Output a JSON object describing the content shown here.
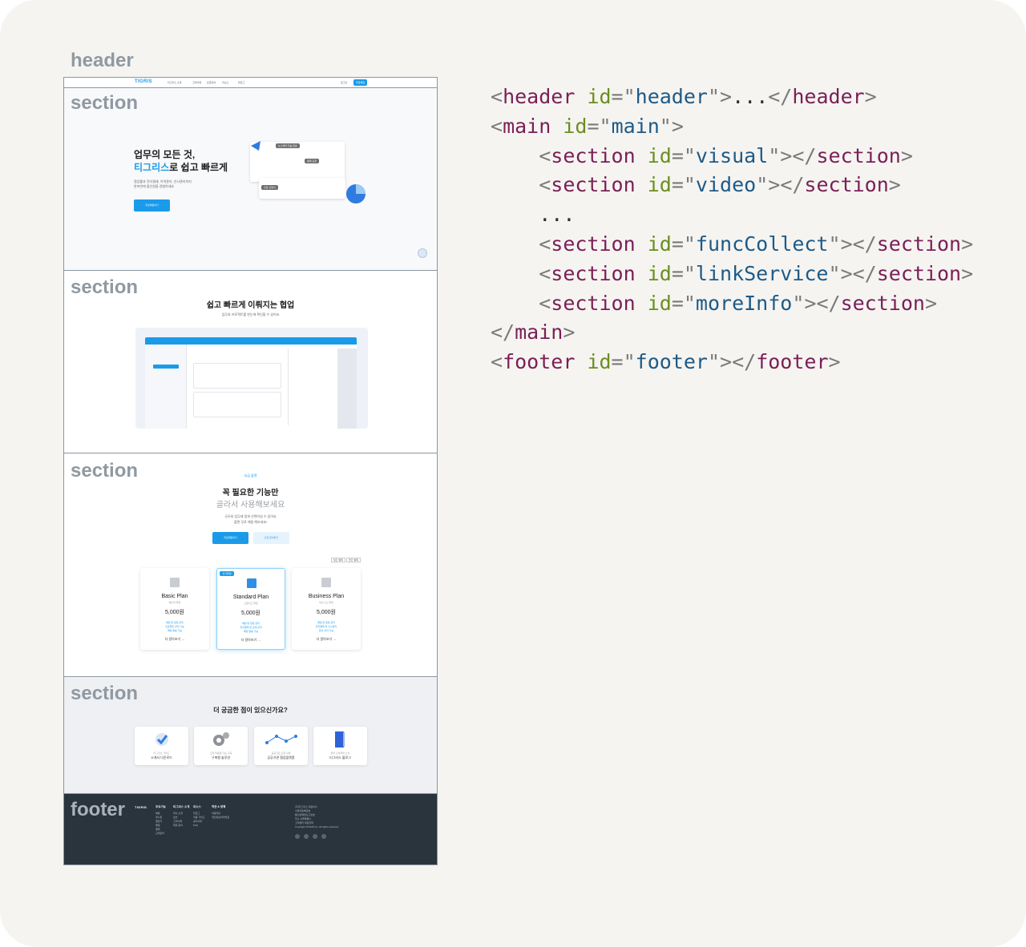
{
  "labels": {
    "header": "header",
    "section": "section",
    "footer": "footer"
  },
  "mock": {
    "header": {
      "logo": "TIGRIS",
      "nav": [
        "티그리스 소개",
        "고객사례",
        "요금안내",
        "리소스",
        "블로그"
      ],
      "login": "로그인",
      "cta": "무료체험"
    },
    "visual": {
      "title_line1": "업무의 모든 것,",
      "title_accent": "티그리스",
      "title_rest": "로 쉽고 빠르게",
      "desc_line1": "협업툴과 전자결재, 이력관리, 인사관리까지",
      "desc_line2": "한꺼번에 올인원을 경험하세요",
      "cta": "무료체험하기",
      "bubbles": [
        "뉴스레터 전송 완료",
        "결재 요청",
        "출장 신청서"
      ]
    },
    "video": {
      "title": "쉽고 빠르게 이뤄지는 협업",
      "subtitle": "업무와 프로젝트를 한눈에 확인할 수 있어요"
    },
    "plan": {
      "badge": "요금 플랜",
      "title": "꼭 필요한 기능만",
      "subtitle": "골라서 사용해보세요",
      "desc_line1": "규모와 업무에 맞게 선택하실 수 있어요",
      "desc_line2": "플랜 무료 체험 해보세요!",
      "btn_primary": "무료체험하기",
      "btn_secondary": "도입 문의하기",
      "toggle": [
        "월간 결제",
        "연간 결제"
      ],
      "featured_tag": "인기플랜",
      "plans": [
        {
          "name": "Basic Plan",
          "sub": "베이직 플랜",
          "price": "5,000원",
          "features": [
            "채팅 및 일정 관리",
            "프로젝트 관리 기능",
            "메일 발송 기능"
          ],
          "more": "더 알아보기 →"
        },
        {
          "name": "Standard Plan",
          "sub": "스탠다드 플랜",
          "price": "5,000원",
          "features": [
            "채팅 및 일정 관리",
            "전자결재 및 근태 관리",
            "메일 발송 기능"
          ],
          "more": "더 알아보기 →"
        },
        {
          "name": "Business Plan",
          "sub": "비즈니스 플랜",
          "price": "5,000원",
          "features": [
            "채팅 및 일정 관리",
            "전자결재 및 인사관리",
            "문서 관리 기능"
          ],
          "more": "더 알아보기 →"
        }
      ]
    },
    "more": {
      "title": "더 궁금한 점이 있으신가요?",
      "cards": [
        {
          "sub": "티그리스 가이드",
          "title": "소개서 다운로드"
        },
        {
          "sub": "조직 맞춤형 기능 구축",
          "title": "구축형 솔루션"
        },
        {
          "sub": "공공기관 도입 사례",
          "title": "공공기관 협업플랫폼"
        },
        {
          "sub": "업무 노하우와 소식",
          "title": "티그리스 블로그"
        }
      ]
    },
    "footer": {
      "logo": "TIGRIS",
      "cols": [
        {
          "head": "주요기능",
          "items": [
            "채팅",
            "게시판",
            "캘린더",
            "메일",
            "결재",
            "근태관리"
          ]
        },
        {
          "head": "티그리스 소개",
          "items": [
            "회사 소개",
            "보안",
            "고객사례",
            "제휴 문의"
          ]
        },
        {
          "head": "리소스",
          "items": [
            "블로그",
            "이용 가이드",
            "공지사항",
            "FAQ"
          ]
        },
        {
          "head": "약관 & 정책",
          "items": [
            "이용약관",
            "개인정보처리방침"
          ]
        }
      ],
      "info_lines": [
        "(주)티그리스 대표이사",
        "사업자등록번호",
        "통신판매업신고번호",
        "주소 서울특별시",
        "고객센터 대표전화",
        "Copyright TIGRIS Inc. All rights reserved."
      ]
    }
  },
  "code": {
    "lines": [
      {
        "indent": 0,
        "tag": "header",
        "id": "header",
        "inner": "..."
      },
      {
        "indent": 0,
        "open": "main",
        "id": "main"
      },
      {
        "indent": 1,
        "tag": "section",
        "id": "visual",
        "inner": ""
      },
      {
        "indent": 1,
        "tag": "section",
        "id": "video",
        "inner": ""
      },
      {
        "indent": 1,
        "ellipsis": "..."
      },
      {
        "indent": 1,
        "tag": "section",
        "id": "funcCollect",
        "inner": ""
      },
      {
        "indent": 1,
        "tag": "section",
        "id": "linkService",
        "inner": ""
      },
      {
        "indent": 1,
        "tag": "section",
        "id": "moreInfo",
        "inner": ""
      },
      {
        "indent": 0,
        "close": "main"
      },
      {
        "indent": 0,
        "tag": "footer",
        "id": "footer",
        "inner": ""
      }
    ]
  }
}
